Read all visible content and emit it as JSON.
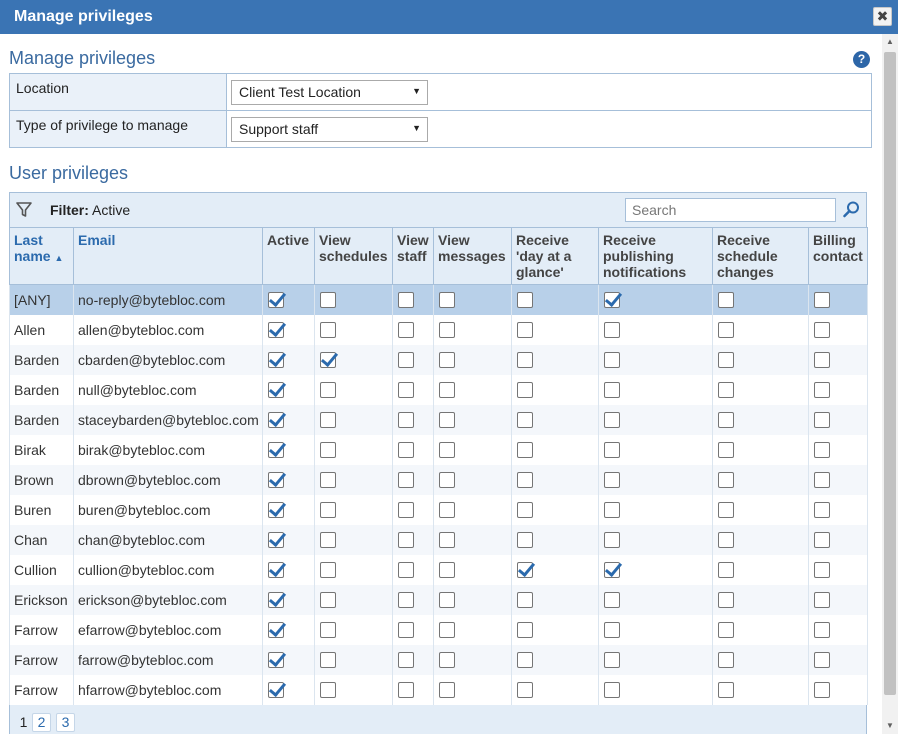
{
  "dialog": {
    "title": "Manage privileges",
    "close_label": "✖"
  },
  "main": {
    "heading": "Manage privileges",
    "help_label": "?",
    "location_label": "Location",
    "location_value": "Client Test Location",
    "privilege_type_label": "Type of privilege to manage",
    "privilege_type_value": "Support staff",
    "user_privileges_heading": "User privileges"
  },
  "toolbar": {
    "filter_label": "Filter:",
    "filter_value": "Active",
    "search_placeholder": "Search"
  },
  "columns": {
    "last_name": "Last name",
    "sort_indicator": "▲",
    "email": "Email",
    "active": "Active",
    "view_schedules": "View schedules",
    "view_staff": "View staff",
    "view_messages": "View messages",
    "receive_day": "Receive 'day at a glance'",
    "receive_publishing": "Receive publishing notifications",
    "receive_schedule_changes": "Receive schedule changes",
    "billing_contact": "Billing contact"
  },
  "rows": [
    {
      "last_name": "[ANY]",
      "email": "no-reply@bytebloc.com",
      "checks": [
        true,
        false,
        false,
        false,
        false,
        true,
        false,
        false
      ]
    },
    {
      "last_name": "Allen",
      "email": "allen@bytebloc.com",
      "checks": [
        true,
        false,
        false,
        false,
        false,
        false,
        false,
        false
      ]
    },
    {
      "last_name": "Barden",
      "email": "cbarden@bytebloc.com",
      "checks": [
        true,
        true,
        false,
        false,
        false,
        false,
        false,
        false
      ]
    },
    {
      "last_name": "Barden",
      "email": "null@bytebloc.com",
      "checks": [
        true,
        false,
        false,
        false,
        false,
        false,
        false,
        false
      ]
    },
    {
      "last_name": "Barden",
      "email": "staceybarden@bytebloc.com",
      "checks": [
        true,
        false,
        false,
        false,
        false,
        false,
        false,
        false
      ]
    },
    {
      "last_name": "Birak",
      "email": "birak@bytebloc.com",
      "checks": [
        true,
        false,
        false,
        false,
        false,
        false,
        false,
        false
      ]
    },
    {
      "last_name": "Brown",
      "email": "dbrown@bytebloc.com",
      "checks": [
        true,
        false,
        false,
        false,
        false,
        false,
        false,
        false
      ]
    },
    {
      "last_name": "Buren",
      "email": "buren@bytebloc.com",
      "checks": [
        true,
        false,
        false,
        false,
        false,
        false,
        false,
        false
      ]
    },
    {
      "last_name": "Chan",
      "email": "chan@bytebloc.com",
      "checks": [
        true,
        false,
        false,
        false,
        false,
        false,
        false,
        false
      ]
    },
    {
      "last_name": "Cullion",
      "email": "cullion@bytebloc.com",
      "checks": [
        true,
        false,
        false,
        false,
        true,
        true,
        false,
        false
      ]
    },
    {
      "last_name": "Erickson",
      "email": "erickson@bytebloc.com",
      "checks": [
        true,
        false,
        false,
        false,
        false,
        false,
        false,
        false
      ]
    },
    {
      "last_name": "Farrow",
      "email": "efarrow@bytebloc.com",
      "checks": [
        true,
        false,
        false,
        false,
        false,
        false,
        false,
        false
      ]
    },
    {
      "last_name": "Farrow",
      "email": "farrow@bytebloc.com",
      "checks": [
        true,
        false,
        false,
        false,
        false,
        false,
        false,
        false
      ]
    },
    {
      "last_name": "Farrow",
      "email": "hfarrow@bytebloc.com",
      "checks": [
        true,
        false,
        false,
        false,
        false,
        false,
        false,
        false
      ]
    }
  ],
  "pager": {
    "current": "1",
    "pages": [
      "2",
      "3"
    ]
  },
  "colors": {
    "accent": "#3a74b4",
    "header_bg": "#e3edf7",
    "selected_row": "#b8d0e9",
    "check": "#2b6aad"
  }
}
